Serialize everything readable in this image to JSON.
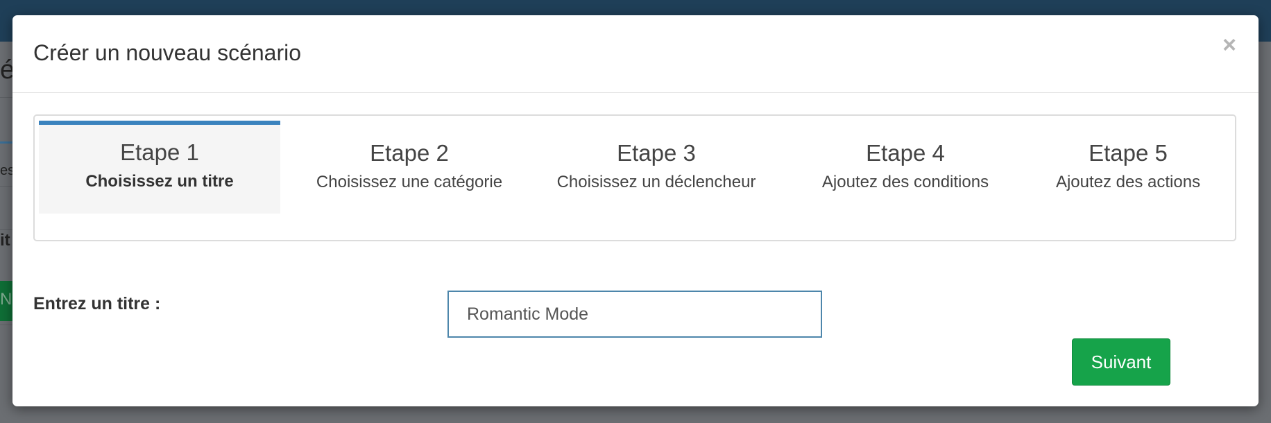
{
  "background": {
    "fragments": [
      "ér",
      "es",
      "it",
      "N"
    ]
  },
  "modal": {
    "title": "Créer un nouveau scénario",
    "close_label": "×"
  },
  "wizard": {
    "steps": [
      {
        "number": "Etape 1",
        "label": "Choisissez un titre",
        "active": true
      },
      {
        "number": "Etape 2",
        "label": "Choisissez une catégorie",
        "active": false
      },
      {
        "number": "Etape 3",
        "label": "Choisissez un déclencheur",
        "active": false
      },
      {
        "number": "Etape 4",
        "label": "Ajoutez des conditions",
        "active": false
      },
      {
        "number": "Etape 5",
        "label": "Ajoutez des actions",
        "active": false
      }
    ]
  },
  "form": {
    "title_label": "Entrez un titre :",
    "title_value": "Romantic Mode"
  },
  "actions": {
    "next_label": "Suivant"
  },
  "colors": {
    "active_step_border": "#3a83be",
    "next_button": "#16a34a",
    "top_bar": "#1f3f58"
  }
}
